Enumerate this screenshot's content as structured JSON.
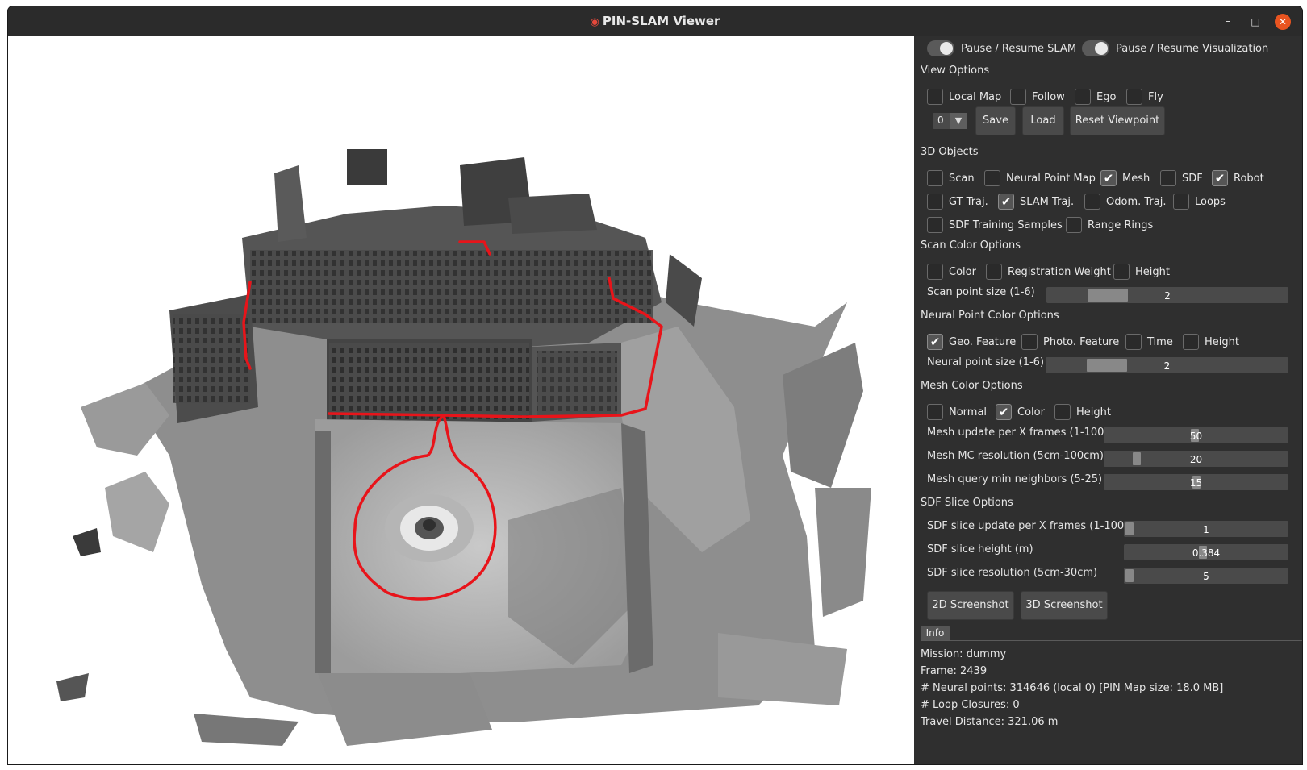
{
  "window": {
    "title": "PIN-SLAM Viewer",
    "title_icon": "map-pin-icon",
    "controls": {
      "minimize": "–",
      "maximize": "□",
      "close": "✕"
    }
  },
  "toggles": {
    "pause_slam": {
      "label": "Pause / Resume SLAM",
      "on": true
    },
    "pause_vis": {
      "label": "Pause / Resume Visualization",
      "on": true
    }
  },
  "view_options": {
    "title": "View Options",
    "items": [
      {
        "label": "Local Map",
        "checked": false
      },
      {
        "label": "Follow",
        "checked": false
      },
      {
        "label": "Ego",
        "checked": false
      },
      {
        "label": "Fly",
        "checked": false
      }
    ],
    "viewpoint_index": "0",
    "save_label": "Save",
    "load_label": "Load",
    "reset_label": "Reset Viewpoint"
  },
  "objects_3d": {
    "title": "3D Objects",
    "items": [
      {
        "label": "Scan",
        "checked": false
      },
      {
        "label": "Neural Point Map",
        "checked": false
      },
      {
        "label": "Mesh",
        "checked": true
      },
      {
        "label": "SDF",
        "checked": false
      },
      {
        "label": "Robot",
        "checked": true
      },
      {
        "label": "GT Traj.",
        "checked": false
      },
      {
        "label": "SLAM Traj.",
        "checked": true
      },
      {
        "label": "Odom. Traj.",
        "checked": false
      },
      {
        "label": "Loops",
        "checked": false
      },
      {
        "label": "SDF Training Samples",
        "checked": false
      },
      {
        "label": "Range Rings",
        "checked": false
      }
    ]
  },
  "scan_color": {
    "title": "Scan Color Options",
    "items": [
      {
        "label": "Color",
        "checked": false
      },
      {
        "label": "Registration Weight",
        "checked": false
      },
      {
        "label": "Height",
        "checked": false
      }
    ],
    "point_size": {
      "label": "Scan point size (1-6)",
      "value": "2",
      "fraction": 0.2
    }
  },
  "neural_color": {
    "title": "Neural Point Color Options",
    "items": [
      {
        "label": "Geo. Feature",
        "checked": true
      },
      {
        "label": "Photo. Feature",
        "checked": false
      },
      {
        "label": "Time",
        "checked": false
      },
      {
        "label": "Height",
        "checked": false
      }
    ],
    "point_size": {
      "label": "Neural point size (1-6)",
      "value": "2",
      "fraction": 0.2
    }
  },
  "mesh_color": {
    "title": "Mesh Color Options",
    "items": [
      {
        "label": "Normal",
        "checked": false
      },
      {
        "label": "Color",
        "checked": true
      },
      {
        "label": "Height",
        "checked": false
      }
    ],
    "sliders": [
      {
        "label": "Mesh update per X frames (1-100)",
        "value": "50",
        "fraction": 0.495
      },
      {
        "label": "Mesh MC resolution (5cm-100cm)",
        "value": "20",
        "fraction": 0.158
      },
      {
        "label": "Mesh query min neighbors (5-25)",
        "value": "15",
        "fraction": 0.5
      }
    ]
  },
  "sdf_slice": {
    "title": "SDF Slice Options",
    "sliders": [
      {
        "label": "SDF slice update per X frames (1-100)",
        "value": "1",
        "fraction": 0.0
      },
      {
        "label": "SDF slice height (m)",
        "value": "0.384",
        "fraction": 0.48
      },
      {
        "label": "SDF slice resolution (5cm-30cm)",
        "value": "5",
        "fraction": 0.0
      }
    ]
  },
  "screenshots": {
    "btn_2d": "2D Screenshot",
    "btn_3d": "3D Screenshot"
  },
  "info": {
    "tab_label": "Info",
    "lines": [
      "Mission: dummy",
      "Frame: 2439",
      "# Neural points: 314646 (local 0) [PIN Map size: 18.0 MB]",
      "# Loop Closures: 0",
      "Travel Distance: 321.06 m"
    ]
  },
  "colors": {
    "trajectory": "#e8141a",
    "panel_bg": "#2f2f2f",
    "close_button": "#e95420"
  }
}
